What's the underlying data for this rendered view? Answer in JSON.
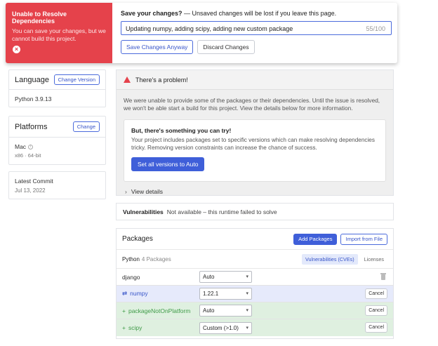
{
  "banner": {
    "error_title": "Unable to Resolve Dependencies",
    "error_message": "You can save your changes, but we cannot build this project.",
    "question_bold": "Save your changes?",
    "question_rest": " — Unsaved changes will be lost if you leave this page.",
    "commit_message": "Updating numpy, adding scipy, adding new custom package",
    "char_count": "55/100",
    "save_label": "Save Changes Anyway",
    "discard_label": "Discard Changes",
    "error_color": "#e5424b"
  },
  "sidebar": {
    "language": {
      "title": "Language",
      "button": "Change Version",
      "value": "Python 3.9.13"
    },
    "platforms": {
      "title": "Platforms",
      "button": "Change",
      "value": "Mac",
      "sub": "x86 · 64-bit",
      "info_icon": "i"
    },
    "commit": {
      "title": "Latest Commit",
      "date": "Jul 13, 2022"
    }
  },
  "problem": {
    "title": "There's a problem!",
    "text": "We were unable to provide some of the packages or their dependencies. Until the issue is resolved, we won't be able start a build for this project. View the details below for more information.",
    "try_title": "But, there's something you can try!",
    "try_text": "Your project includes packages set to specific versions which can make resolving dependencies tricky. Removing version constraints can increase the chance of success.",
    "try_button": "Set all versions to Auto",
    "view_details": "View details"
  },
  "vulnerabilities": {
    "label": "Vulnerabilities",
    "text": "Not available – this runtime failed to solve"
  },
  "packages": {
    "title": "Packages",
    "add_button": "Add Packages",
    "import_button": "Import from File",
    "language": "Python",
    "count": "4 Packages",
    "tabs": [
      "Vulnerabilities (CVEs)",
      "Licenses"
    ],
    "rows": [
      {
        "name": "django",
        "version": "Auto",
        "status": "unchanged",
        "symbol": ""
      },
      {
        "name": "numpy",
        "version": "1.22.1",
        "status": "updated",
        "symbol": "⇄",
        "action": "Cancel"
      },
      {
        "name": "packageNotOnPlatform",
        "version": "Auto",
        "status": "added",
        "symbol": "+",
        "action": "Cancel"
      },
      {
        "name": "scipy",
        "version": "Custom (>1.0)",
        "status": "added",
        "symbol": "+",
        "action": "Cancel"
      }
    ]
  }
}
